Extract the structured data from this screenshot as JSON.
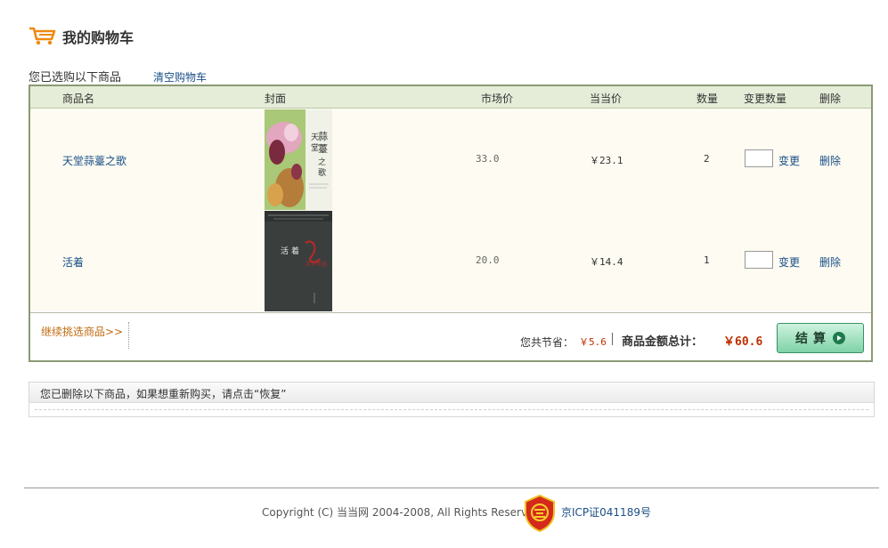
{
  "header": {
    "title": "我的购物车",
    "cart_icon": "shopping-cart-icon",
    "icon_color": "#f08a12"
  },
  "selection": {
    "label": "您已选购以下商品",
    "clear_cart": "清空购物车"
  },
  "table": {
    "columns": [
      "商品名",
      "封面",
      "市场价",
      "当当价",
      "数量",
      "变更数量",
      "删除"
    ],
    "rows": [
      {
        "name": "天堂蒜薹之歌",
        "market_price": "33.0",
        "dangdang_price": "￥23.1",
        "qty": "2",
        "qty_input": "",
        "change": "变更",
        "delete": "删除",
        "cover_title": "天堂蒜薹之歌"
      },
      {
        "name": "活着",
        "market_price": "20.0",
        "dangdang_price": "￥14.4",
        "qty": "1",
        "qty_input": "",
        "change": "变更",
        "delete": "删除",
        "cover_title": "活着"
      }
    ]
  },
  "summary": {
    "continue": "继续挑选商品>>",
    "save_label": "您共节省：",
    "save_value": "￥5.6",
    "total_label": "商品金额总计：",
    "total_value": "￥60.6",
    "checkout": "结算"
  },
  "deleted": {
    "message": "您已删除以下商品，如果想重新购买，请点击“恢复”"
  },
  "footer": {
    "copyright": "Copyright (C) 当当网 2004-2008, All Rights Reserved",
    "icp": "京ICP证041189号"
  },
  "colors": {
    "header_bg": "#e5edd8",
    "border": "#8a9a73",
    "price_red": "#c03000",
    "link_blue": "#1a4f86",
    "accent_orange": "#c06a10"
  }
}
